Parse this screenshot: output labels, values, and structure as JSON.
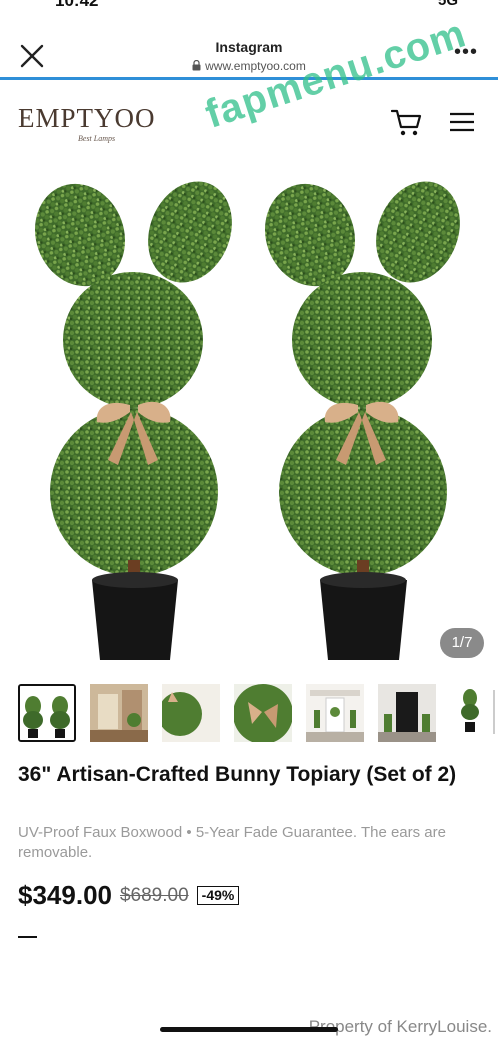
{
  "status_bar": {
    "time": "10:42",
    "signal_text": "5G"
  },
  "browser": {
    "title": "Instagram",
    "url": "www.emptyoo.com",
    "close_icon": "close-icon",
    "lock_icon": "lock-icon",
    "more_icon": "more-dots-icon",
    "accent_color": "#2f8fd8"
  },
  "site": {
    "logo_text": "EMPTYOO",
    "logo_tagline": "Best Lamps",
    "cart_icon": "cart-icon",
    "menu_icon": "hamburger-menu-icon"
  },
  "watermark": "fapmenu.com",
  "gallery": {
    "counter": "1/7",
    "thumbnails": [
      {
        "label": "thumb-1",
        "selected": true
      },
      {
        "label": "thumb-2",
        "selected": false
      },
      {
        "label": "thumb-3",
        "selected": false
      },
      {
        "label": "thumb-4",
        "selected": false
      },
      {
        "label": "thumb-5",
        "selected": false
      },
      {
        "label": "thumb-6",
        "selected": false
      },
      {
        "label": "thumb-7",
        "selected": false
      }
    ]
  },
  "product": {
    "title": "36\" Artisan-Crafted Bunny Topiary (Set of 2)",
    "subtitle": "UV-Proof Faux Boxwood • 5-Year Fade Guarantee. The ears are removable.",
    "price": "$349.00",
    "original_price": "$689.00",
    "discount": "-49%"
  },
  "footer": {
    "property_text": "Property of KerryLouise."
  }
}
